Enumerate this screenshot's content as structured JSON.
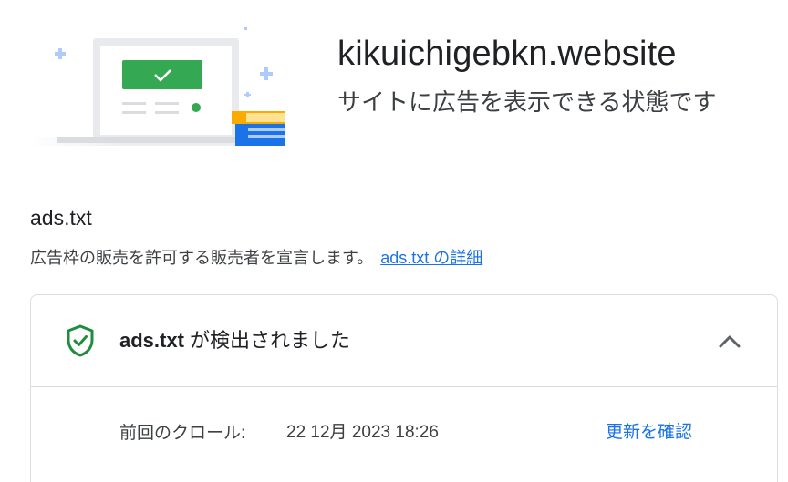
{
  "site": {
    "domain": "kikuichigebkn.website",
    "status": "サイトに広告を表示できる状態です"
  },
  "ads_txt": {
    "title": "ads.txt",
    "description": "広告枠の販売を許可する販売者を宣言します。",
    "details_link": "ads.txt の詳細"
  },
  "card": {
    "title_strong": "ads.txt",
    "title_rest": " が検出されました",
    "status_icon": "shield-check-icon",
    "expand_icon": "chevron-up-icon",
    "last_crawl_label": "前回のクロール:",
    "last_crawl_value": "22 12月 2023 18:26",
    "check_update_label": "更新を確認"
  },
  "colors": {
    "accent": "#1a73e8",
    "success": "#1e8e3e",
    "check_box": "#34a853",
    "border": "#dadce0"
  }
}
